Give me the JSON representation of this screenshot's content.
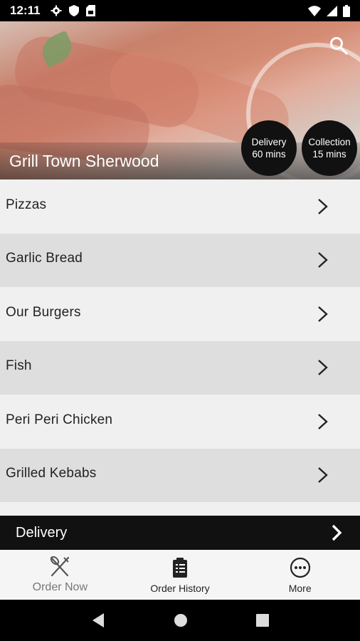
{
  "status_bar": {
    "time": "12:11",
    "left_icons": [
      "gear-icon",
      "shield-icon",
      "sim-icon"
    ],
    "right_icons": [
      "wifi-icon",
      "signal-icon",
      "battery-icon"
    ]
  },
  "hero": {
    "restaurant_name": "Grill Town Sherwood",
    "delivery": {
      "label": "Delivery",
      "time": "60 mins"
    },
    "collection": {
      "label": "Collection",
      "time": "15 mins"
    }
  },
  "categories": [
    {
      "label": "Pizzas"
    },
    {
      "label": "Garlic Bread"
    },
    {
      "label": "Our Burgers"
    },
    {
      "label": "Fish"
    },
    {
      "label": "Peri Peri Chicken"
    },
    {
      "label": "Grilled Kebabs"
    }
  ],
  "delivery_bar": {
    "label": "Delivery"
  },
  "bottom_nav": {
    "items": [
      {
        "label": "Order Now",
        "icon": "fork-knife-icon"
      },
      {
        "label": "Order History",
        "icon": "clipboard-icon"
      },
      {
        "label": "More",
        "icon": "more-icon"
      }
    ]
  },
  "colors": {
    "dark": "#111111",
    "row_light": "#f0f0f0",
    "row_dark": "#dedede",
    "nav_bg": "#f5f5f5"
  }
}
